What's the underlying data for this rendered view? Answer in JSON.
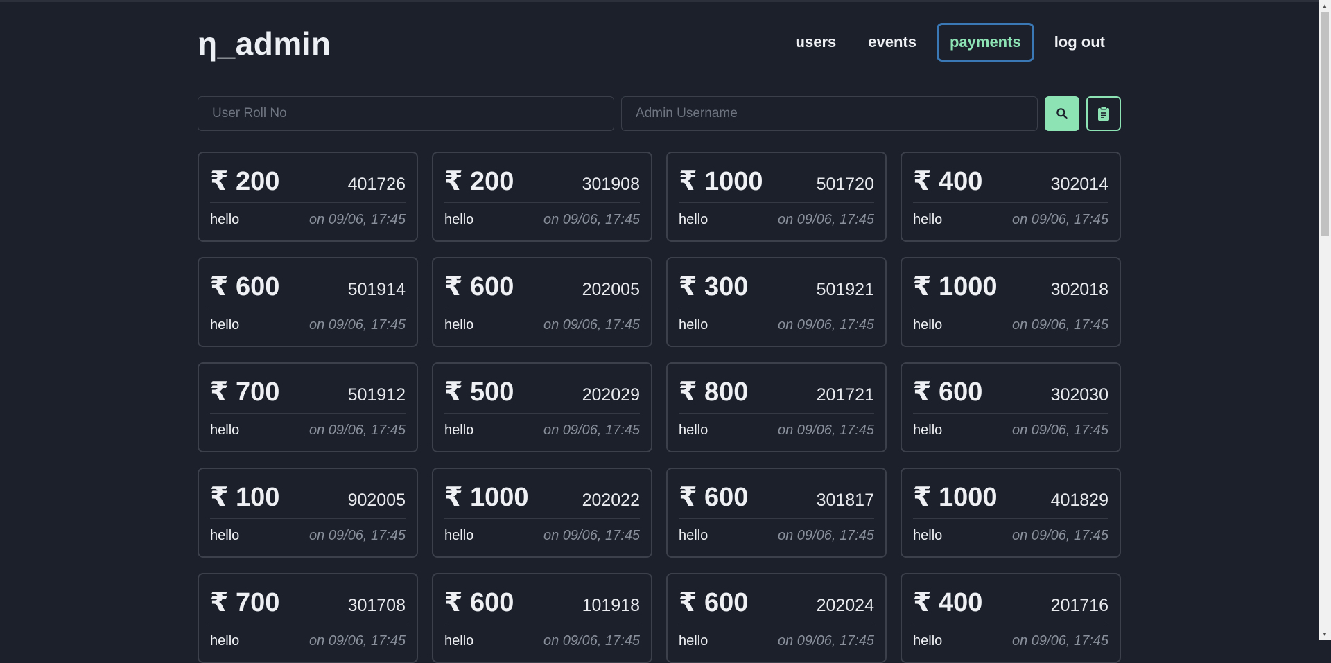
{
  "brand": "η_admin",
  "nav": [
    {
      "label": "users",
      "active": false
    },
    {
      "label": "events",
      "active": false
    },
    {
      "label": "payments",
      "active": true
    },
    {
      "label": "log out",
      "active": false
    }
  ],
  "search": {
    "roll_placeholder": "User Roll No",
    "admin_placeholder": "Admin Username",
    "search_icon": "search-icon",
    "clipboard_icon": "clipboard-icon"
  },
  "colors": {
    "accent": "#8ee3b5",
    "active_border": "#3a78b5",
    "background": "#1b202b"
  },
  "payments": [
    {
      "amount": "₹ 200",
      "roll": "401726",
      "note": "hello",
      "date": "on 09/06, 17:45"
    },
    {
      "amount": "₹ 200",
      "roll": "301908",
      "note": "hello",
      "date": "on 09/06, 17:45"
    },
    {
      "amount": "₹ 1000",
      "roll": "501720",
      "note": "hello",
      "date": "on 09/06, 17:45"
    },
    {
      "amount": "₹ 400",
      "roll": "302014",
      "note": "hello",
      "date": "on 09/06, 17:45"
    },
    {
      "amount": "₹ 600",
      "roll": "501914",
      "note": "hello",
      "date": "on 09/06, 17:45"
    },
    {
      "amount": "₹ 600",
      "roll": "202005",
      "note": "hello",
      "date": "on 09/06, 17:45"
    },
    {
      "amount": "₹ 300",
      "roll": "501921",
      "note": "hello",
      "date": "on 09/06, 17:45"
    },
    {
      "amount": "₹ 1000",
      "roll": "302018",
      "note": "hello",
      "date": "on 09/06, 17:45"
    },
    {
      "amount": "₹ 700",
      "roll": "501912",
      "note": "hello",
      "date": "on 09/06, 17:45"
    },
    {
      "amount": "₹ 500",
      "roll": "202029",
      "note": "hello",
      "date": "on 09/06, 17:45"
    },
    {
      "amount": "₹ 800",
      "roll": "201721",
      "note": "hello",
      "date": "on 09/06, 17:45"
    },
    {
      "amount": "₹ 600",
      "roll": "302030",
      "note": "hello",
      "date": "on 09/06, 17:45"
    },
    {
      "amount": "₹ 100",
      "roll": "902005",
      "note": "hello",
      "date": "on 09/06, 17:45"
    },
    {
      "amount": "₹ 1000",
      "roll": "202022",
      "note": "hello",
      "date": "on 09/06, 17:45"
    },
    {
      "amount": "₹ 600",
      "roll": "301817",
      "note": "hello",
      "date": "on 09/06, 17:45"
    },
    {
      "amount": "₹ 1000",
      "roll": "401829",
      "note": "hello",
      "date": "on 09/06, 17:45"
    },
    {
      "amount": "₹ 700",
      "roll": "301708",
      "note": "hello",
      "date": "on 09/06, 17:45"
    },
    {
      "amount": "₹ 600",
      "roll": "101918",
      "note": "hello",
      "date": "on 09/06, 17:45"
    },
    {
      "amount": "₹ 600",
      "roll": "202024",
      "note": "hello",
      "date": "on 09/06, 17:45"
    },
    {
      "amount": "₹ 400",
      "roll": "201716",
      "note": "hello",
      "date": "on 09/06, 17:45"
    }
  ]
}
